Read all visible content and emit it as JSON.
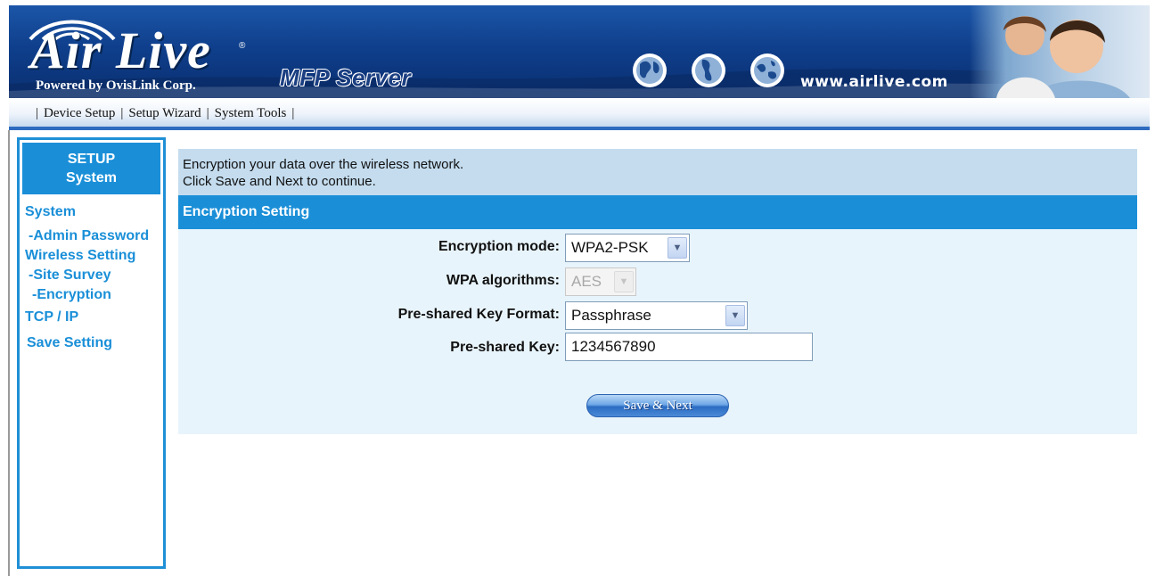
{
  "header": {
    "brand": "Air Live",
    "registered_mark": "®",
    "powered_by": "Powered by OvisLink Corp.",
    "product": "MFP Server",
    "website": "www.airlive.com",
    "colors": {
      "header_dark": "#0f3f8c",
      "accent": "#1a8fd8"
    }
  },
  "nav": {
    "items": [
      {
        "label": "Device Setup"
      },
      {
        "label": "Setup Wizard"
      },
      {
        "label": "System Tools"
      }
    ],
    "separator": "|"
  },
  "sidebar": {
    "header_line1": "SETUP",
    "header_line2": "System",
    "links": {
      "system": "System",
      "admin_password": "-Admin Password",
      "wireless_setting": "Wireless Setting",
      "site_survey": "-Site Survey",
      "encryption": "-Encryption",
      "tcp_ip": "TCP / IP",
      "save_setting": "Save Setting"
    }
  },
  "main": {
    "intro_line1": "Encryption your data over the wireless network.",
    "intro_line2": "Click Save and Next to continue.",
    "section_title": "Encryption Setting",
    "form": {
      "encryption_mode_label": "Encryption mode:",
      "encryption_mode_value": "WPA2-PSK",
      "wpa_algorithms_label": "WPA algorithms:",
      "wpa_algorithms_value": "AES",
      "key_format_label": "Pre-shared Key Format:",
      "key_format_value": "Passphrase",
      "key_label": "Pre-shared Key:",
      "key_value": "1234567890"
    },
    "save_button": "Save & Next"
  },
  "icons": {
    "dropdown": "chevron-down-icon",
    "globe": "globe-icon",
    "signal": "wireless-signal-icon"
  }
}
